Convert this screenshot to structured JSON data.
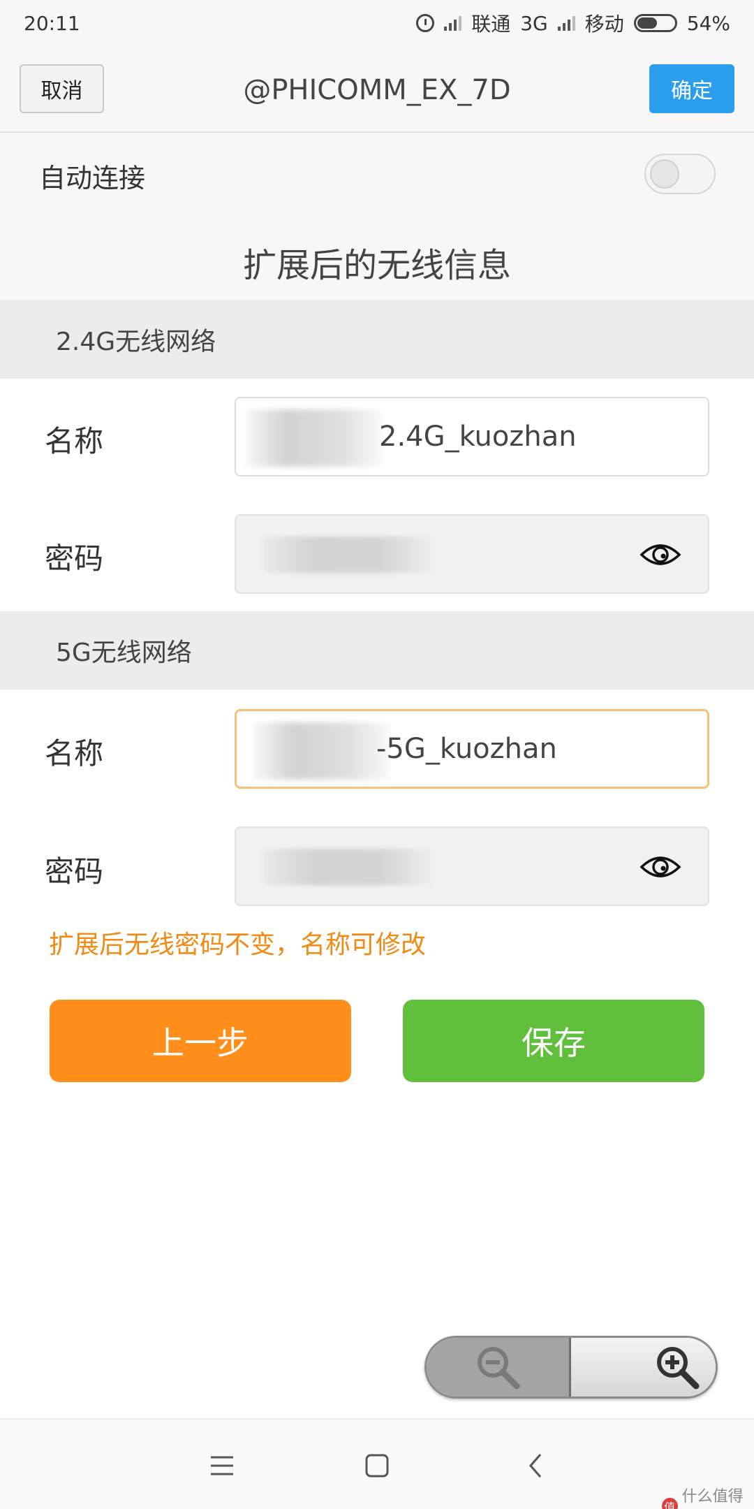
{
  "status_bar": {
    "time": "20:11",
    "carrier1": "联通",
    "network1": "3G",
    "carrier2": "移动",
    "battery": "54%",
    "battery_level": 0.54
  },
  "header": {
    "cancel_label": "取消",
    "title": "@PHICOMM_EX_7D",
    "confirm_label": "确定"
  },
  "auto_connect": {
    "label": "自动连接",
    "enabled": false
  },
  "section_title": "扩展后的无线信息",
  "network_24g": {
    "header": "2.4G无线网络",
    "name_label": "名称",
    "name_value": "2.4G_kuozhan",
    "password_label": "密码"
  },
  "network_5g": {
    "header": "5G无线网络",
    "name_label": "名称",
    "name_value": "-5G_kuozhan",
    "password_label": "密码"
  },
  "hint": "扩展后无线密码不变，名称可修改",
  "buttons": {
    "prev_label": "上一步",
    "save_label": "保存"
  },
  "watermark": "什么值得买",
  "colors": {
    "confirm": "#2b9ded",
    "prev": "#ff8f1a",
    "save": "#60bf3b",
    "hint": "#f08a12"
  }
}
